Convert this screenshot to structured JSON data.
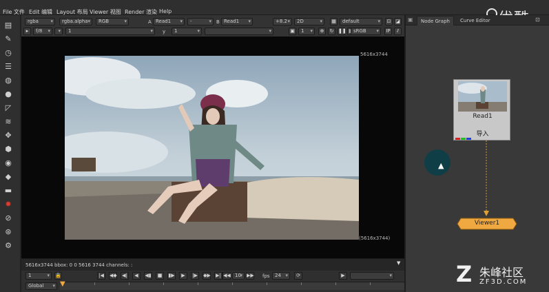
{
  "menu": {
    "items": [
      "File 文件",
      "Edit 编辑",
      "Layout 布局",
      "Viewer 视图",
      "Render 渲染",
      "Help"
    ],
    "brand": "优酷"
  },
  "viewer_toolbar": {
    "channels": "rgba",
    "alpha": "rgba.alpha",
    "colorspace": "RGB",
    "a_label": "A",
    "a_input": "Read1",
    "operation": "-",
    "b_label": "B",
    "b_input": "Read1",
    "gain": "+8.2",
    "view_mode": "2D",
    "lut": "default",
    "fstop": "f/8",
    "frame": "1",
    "y_label": "y",
    "y_value": "1",
    "proxy": "1",
    "output_lut": "sRGB"
  },
  "viewer": {
    "resolution_top": "5616x3744",
    "resolution_bottom": "(5616x3744)",
    "info": "5616x3744  bbox: 0 0 5616 3744  channels: :"
  },
  "transport": {
    "frame_field": "1",
    "skip_value": "10",
    "fps_label": "fps",
    "fps_value": "24",
    "global_label": "Global",
    "buttons": [
      "first-frame",
      "prev-keyframe",
      "prev-frame",
      "play-backward",
      "stop",
      "play-forward",
      "next-frame",
      "next-keyframe",
      "last-frame"
    ]
  },
  "right_panel": {
    "tabs": [
      "Node Graph",
      "Curve Editor"
    ],
    "read_node": {
      "title": "Read1",
      "hash": "97dda144ad34d52f53dad0a20ef430ad85d",
      "label": "导入"
    },
    "viewer_node": {
      "title": "Viewer1"
    }
  },
  "watermark": {
    "cn": "朱峰社区",
    "en": "ZF3D.COM"
  },
  "colors": {
    "node_fill": "#c8c8c8",
    "viewer_node_fill": "#f0a840",
    "dot_node": "#103e46",
    "accent_red": "#e03a2e"
  },
  "icons": [
    "viewer-icon",
    "pen-icon",
    "clock-icon",
    "channel-icon",
    "shape-icon",
    "circle-icon",
    "crop-icon",
    "layers-icon",
    "transform-icon",
    "cube-icon",
    "eye-icon",
    "tag-icon",
    "box-icon",
    "fire-icon",
    "settings-icon",
    "node-icon",
    "gear-icon"
  ]
}
